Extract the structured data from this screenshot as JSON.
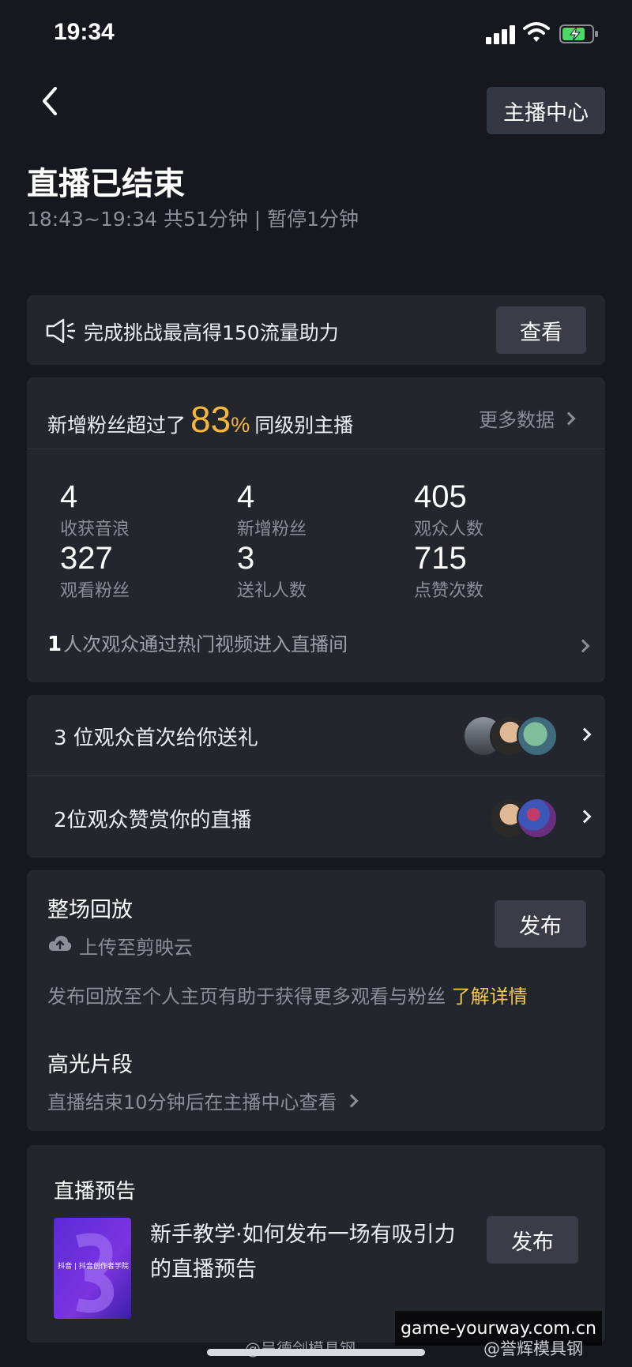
{
  "status_bar": {
    "time": "19:34"
  },
  "header": {
    "host_center_label": "主播中心"
  },
  "summary": {
    "title": "直播已结束",
    "subtitle": "18:43~19:34 共51分钟 | 暂停1分钟"
  },
  "challenge": {
    "text": "完成挑战最高得150流量助力",
    "button": "查看"
  },
  "stats": {
    "fans_prefix": "新增粉丝超过了",
    "fans_percent": "83",
    "percent_sign": "%",
    "fans_suffix": "同级别主播",
    "more_label": "更多数据",
    "items": [
      {
        "value": "4",
        "label": "收获音浪"
      },
      {
        "value": "4",
        "label": "新增粉丝"
      },
      {
        "value": "405",
        "label": "观众人数"
      },
      {
        "value": "327",
        "label": "观看粉丝"
      },
      {
        "value": "3",
        "label": "送礼人数"
      },
      {
        "value": "715",
        "label": "点赞次数"
      }
    ],
    "traffic_count": "1",
    "traffic_text": "人次观众通过热门视频进入直播间"
  },
  "gifts": {
    "first_gift_text": "3 位观众首次给你送礼",
    "appreciation_text": "2位观众赞赏你的直播"
  },
  "replay": {
    "title": "整场回放",
    "button": "发布",
    "upload_text": "上传至剪映云",
    "desc": "发布回放至个人主页有助于获得更多观看与粉丝",
    "learn_more": "了解详情",
    "highlight_title": "高光片段",
    "highlight_desc": "直播结束10分钟后在主播中心查看"
  },
  "preview": {
    "title": "直播预告",
    "thumb_caption": "抖音 | 抖音创作者学院",
    "text": "新手教学·如何发布一场有吸引力的直播预告",
    "button": "发布"
  },
  "watermarks": {
    "site": "game-yourway.com.cn",
    "weibo": "@吴德剑模具钢",
    "right": "@誉辉模具钢"
  },
  "colors": {
    "accent": "#f4b73c",
    "link": "#f4c94b",
    "background": "#17181f",
    "card": "#24262e"
  },
  "icons": [
    "back-arrow-icon",
    "speaker-icon",
    "cloud-upload-icon",
    "chevron-right-icon"
  ]
}
